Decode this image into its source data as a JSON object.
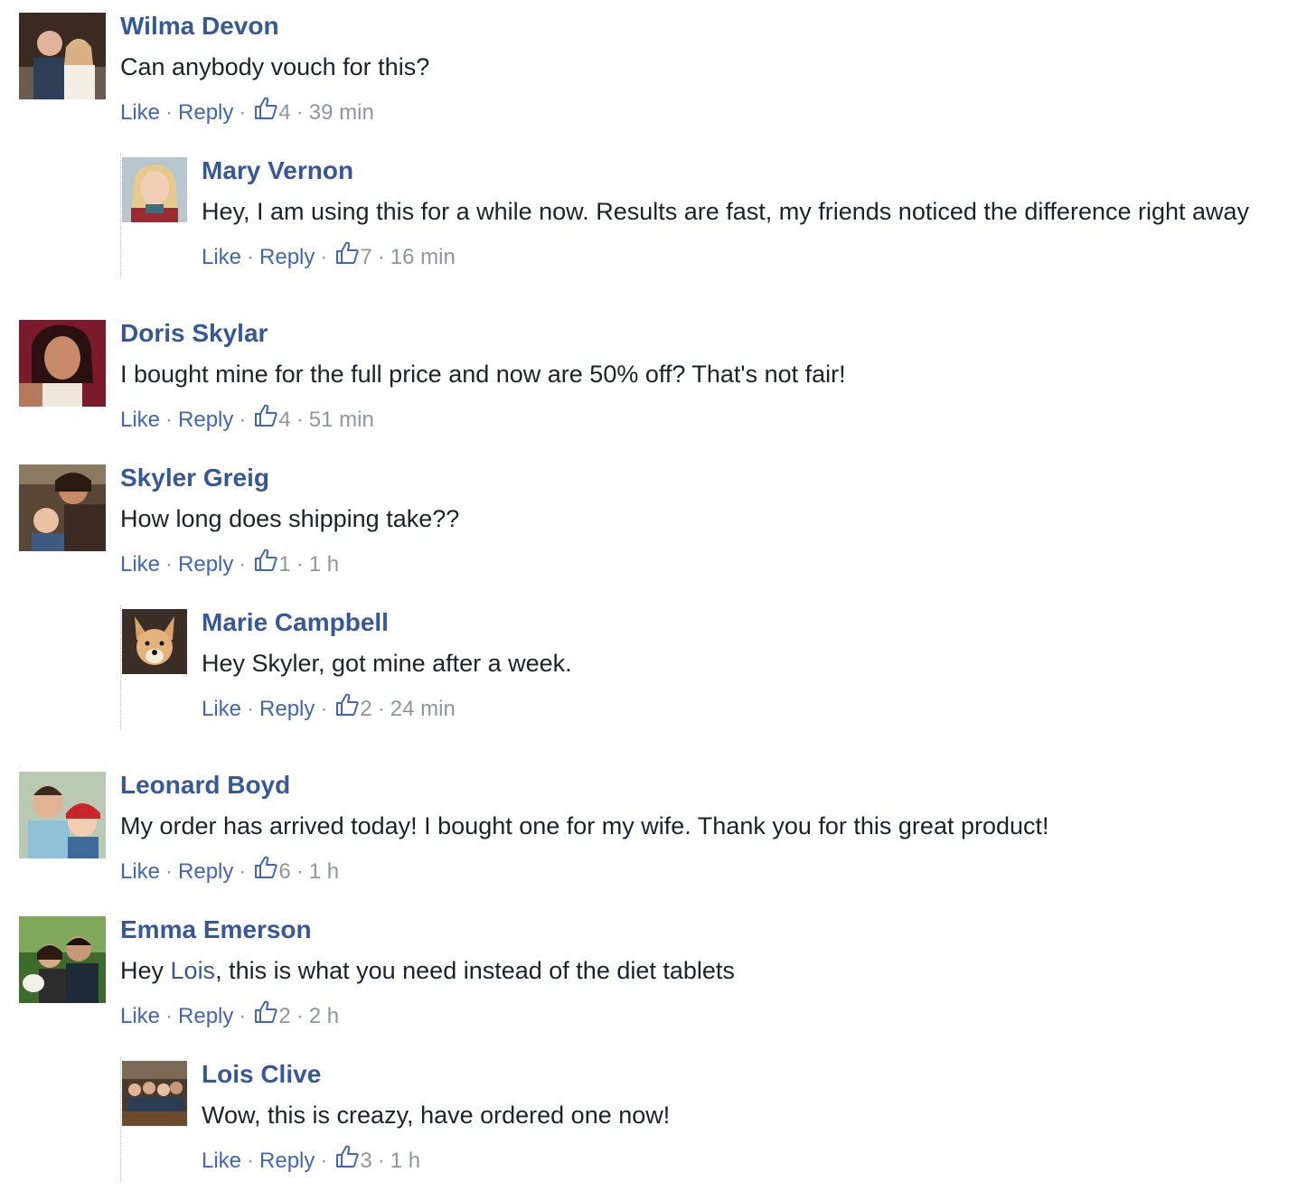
{
  "colors": {
    "author": "#365899",
    "action_link": "#4267b2",
    "meta": "#90949c",
    "text": "#1d2129"
  },
  "actions": {
    "like": "Like",
    "reply": "Reply",
    "separator": "·"
  },
  "comments": [
    {
      "author": "Wilma Devon",
      "text": "Can anybody vouch for this?",
      "likes": "4",
      "time": "39 min",
      "avatar": "avatar-couple-photo",
      "replies": [
        {
          "author": "Mary Vernon",
          "text": "Hey, I am using this for a while now. Results are fast, my friends noticed the difference right away",
          "likes": "7",
          "time": "16 min",
          "avatar": "avatar-blonde-woman-photo"
        }
      ]
    },
    {
      "author": "Doris Skylar",
      "text": "I bought mine for the full price and now are 50% off? That's not fair!",
      "likes": "4",
      "time": "51 min",
      "avatar": "avatar-woman-selfie-photo",
      "replies": []
    },
    {
      "author": "Skyler Greig",
      "text": "How long does shipping take??",
      "likes": "1",
      "time": "1 h",
      "avatar": "avatar-woman-with-baby-photo",
      "replies": [
        {
          "author": "Marie Campbell",
          "text": "Hey Skyler, got mine after a week.",
          "likes": "2",
          "time": "24 min",
          "avatar": "avatar-dog-photo"
        }
      ]
    },
    {
      "author": "Leonard Boyd",
      "text": "My order has arrived today! I bought one for my wife. Thank you for this great product!",
      "likes": "6",
      "time": "1 h",
      "avatar": "avatar-man-with-child-photo",
      "replies": []
    },
    {
      "author": "Emma Emerson",
      "text_prefix": "Hey ",
      "mention": "Lois",
      "text_suffix": ", this is what you need instead of the diet tablets",
      "likes": "2",
      "time": "2 h",
      "avatar": "avatar-couple-with-dog-photo",
      "replies": [
        {
          "author": "Lois Clive",
          "text": "Wow, this is creazy, have ordered one now!",
          "likes": "3",
          "time": "1 h",
          "avatar": "avatar-group-restaurant-photo"
        }
      ]
    }
  ]
}
